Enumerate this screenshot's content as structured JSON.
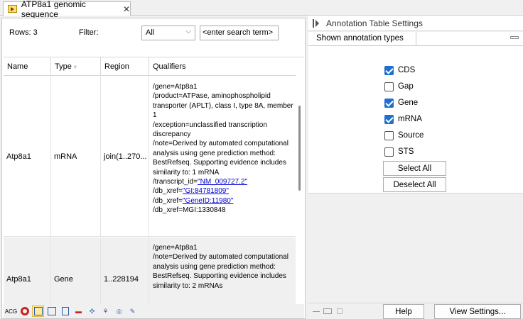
{
  "tab": {
    "title": "ATP8a1 genomic sequence",
    "close": "✕",
    "icon": "sequence-icon"
  },
  "toolbar": {
    "rows_label": "Rows: 3",
    "filter_label": "Filter:",
    "filter_value": "All",
    "search_value": "<enter search term>"
  },
  "table": {
    "columns": [
      "Name",
      "Type",
      "Region",
      "Qualifiers"
    ],
    "rows": [
      {
        "name": "Atp8a1",
        "type": "mRNA",
        "region": "join(1..270...",
        "qualifiers": {
          "gene": "/gene=Atp8a1",
          "product": "/product=ATPase, aminophospholipid transporter (APLT), class I, type 8A, member 1",
          "exception": "/exception=unclassified transcription discrepancy",
          "note": "/note=Derived by automated computational analysis using gene prediction method: BestRefseq. Supporting evidence includes similarity to: 1 mRNA",
          "transcript_prefix": "/transcript_id=",
          "transcript_link": "\"NM_009727.2\"",
          "xref1_prefix": "/db_xref=",
          "xref1_link": "\"GI:84781809\"",
          "xref2_prefix": "/db_xref=",
          "xref2_link": "\"GeneID:11980\"",
          "xref3": "/db_xref=MGI:1330848"
        }
      },
      {
        "name": "Atp8a1",
        "type": "Gene",
        "region": "1..228194",
        "qualifiers": {
          "gene": "/gene=Atp8a1",
          "note": "/note=Derived by automated computational analysis using gene prediction method: BestRefseq. Supporting evidence includes similarity to: 2 mRNAs"
        }
      }
    ]
  },
  "settings": {
    "title": "Annotation Table Settings",
    "section": "Shown annotation types",
    "types": [
      {
        "label": "CDS",
        "checked": true
      },
      {
        "label": "Gap",
        "checked": false
      },
      {
        "label": "Gene",
        "checked": true
      },
      {
        "label": "mRNA",
        "checked": true
      },
      {
        "label": "Source",
        "checked": false
      },
      {
        "label": "STS",
        "checked": false
      }
    ],
    "select_all": "Select All",
    "deselect_all": "Deselect All",
    "help": "Help",
    "view_settings": "View Settings..."
  },
  "view_tools": [
    "text-view-icon",
    "circular-view-icon",
    "linear-view-icon",
    "table-view-icon",
    "text-doc-icon",
    "restriction-icon",
    "graph-icon",
    "tree-icon",
    "history-icon",
    "edit-icon"
  ],
  "colors": {
    "checkbox": "#1f6fcc",
    "link": "#0000cc",
    "active_tool": "#ffe99a"
  }
}
